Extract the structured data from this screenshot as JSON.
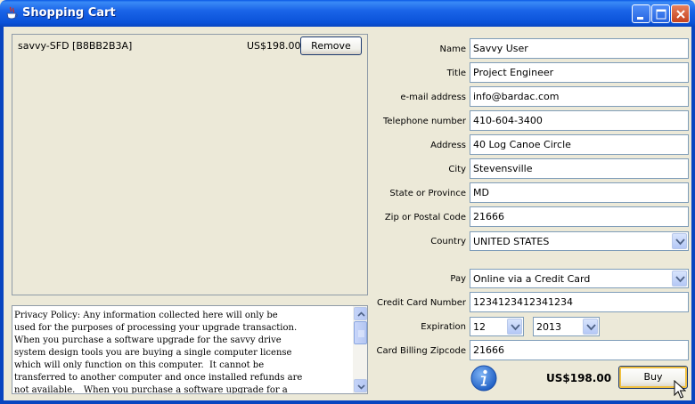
{
  "window": {
    "title": "Shopping Cart"
  },
  "cart": {
    "items": [
      {
        "name": "savvy-SFD [B8BB2B3A]",
        "price": "US$198.00",
        "remove_label": "Remove"
      }
    ]
  },
  "privacy": {
    "text": "Privacy Policy: Any information collected here will only be\nused for the purposes of processing your upgrade transaction.\nWhen you purchase a software upgrade for the savvy drive\nsystem design tools you are buying a single computer license\nwhich will only function on this computer.  It cannot be\ntransferred to another computer and once installed refunds are\nnot available.   When you purchase a software upgrade for a"
  },
  "form": {
    "name": {
      "label": "Name",
      "value": "Savvy User"
    },
    "title": {
      "label": "Title",
      "value": "Project Engineer"
    },
    "email": {
      "label": "e-mail address",
      "value": "info@bardac.com"
    },
    "phone": {
      "label": "Telephone number",
      "value": "410-604-3400"
    },
    "address": {
      "label": "Address",
      "value": "40 Log Canoe Circle"
    },
    "city": {
      "label": "City",
      "value": "Stevensville"
    },
    "state": {
      "label": "State or Province",
      "value": "MD"
    },
    "zip": {
      "label": "Zip or Postal Code",
      "value": "21666"
    },
    "country": {
      "label": "Country",
      "value": "UNITED STATES"
    },
    "pay": {
      "label": "Pay",
      "value": "Online via a Credit Card"
    },
    "card_number": {
      "label": "Credit Card Number",
      "value": "1234123412341234"
    },
    "expiration": {
      "label": "Expiration",
      "month": "12",
      "year": "2013"
    },
    "billing_zip": {
      "label": "Card Billing Zipcode",
      "value": "21666"
    }
  },
  "footer": {
    "total": "US$198.00",
    "buy_label": "Buy"
  },
  "colors": {
    "titlebar": "#0a52d8",
    "background": "#ece9d8",
    "info_icon": "#2a6fd0"
  },
  "icons": [
    "java-cup-icon",
    "minimize-icon",
    "maximize-icon",
    "close-icon",
    "info-icon",
    "chevron-down-icon",
    "mouse-cursor-icon"
  ]
}
